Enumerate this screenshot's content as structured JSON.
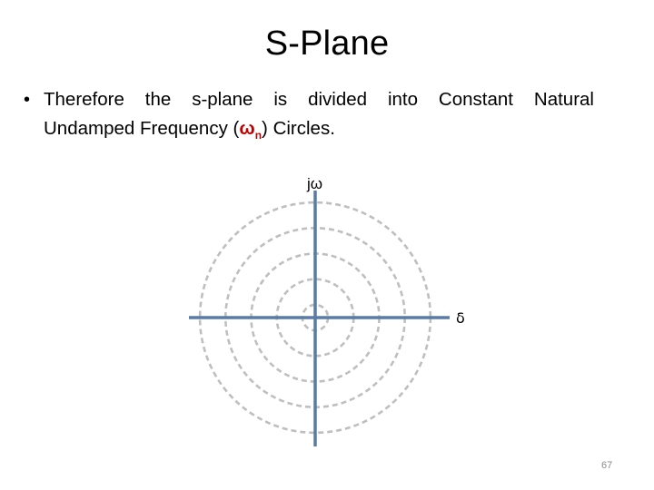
{
  "slide": {
    "title": "S-Plane",
    "bullet": {
      "line1_words": [
        "Therefore",
        "the",
        "s-plane",
        "is",
        "divided",
        "into",
        "Constant",
        "Natural"
      ],
      "line2_prefix": "Undamped Frequency (",
      "symbol": "ω",
      "symbol_subscript": "n",
      "line2_suffix": ") Circles."
    },
    "page_number": "67"
  },
  "diagram": {
    "vertical_axis_label": "jω",
    "horizontal_axis_label": "δ",
    "circle_count": 5,
    "circle_relative_radii": [
      1,
      3,
      5,
      7,
      9
    ],
    "colors": {
      "axis": "#5b7ba6",
      "circles": "#bfbfbf",
      "highlight": "#c00000"
    }
  }
}
